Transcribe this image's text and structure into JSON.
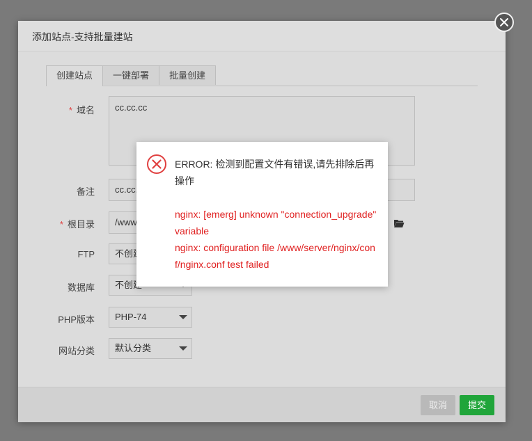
{
  "modal": {
    "title": "添加站点-支持批量建站",
    "tabs": [
      {
        "label": "创建站点",
        "active": true
      },
      {
        "label": "一键部署",
        "active": false
      },
      {
        "label": "批量创建",
        "active": false
      }
    ]
  },
  "form": {
    "domain": {
      "label": "域名",
      "required": true,
      "value": "cc.cc.cc"
    },
    "remark": {
      "label": "备注",
      "value": "cc.cc."
    },
    "root": {
      "label": "根目录",
      "required": true,
      "value": "/www"
    },
    "ftp": {
      "label": "FTP",
      "value": "不创建"
    },
    "database": {
      "label": "数据库",
      "value": "不创建"
    },
    "php": {
      "label": "PHP版本",
      "value": "PHP-74"
    },
    "category": {
      "label": "网站分类",
      "value": "默认分类"
    }
  },
  "footer": {
    "cancel_label": "取消",
    "submit_label": "提交"
  },
  "error_dialog": {
    "title": "ERROR: 检测到配置文件有错误,请先排除后再操作",
    "lines": [
      "nginx: [emerg] unknown \"connection_upgrade\" variable",
      "nginx: configuration file /www/server/nginx/conf/nginx.conf test failed"
    ]
  },
  "colors": {
    "accent": "#20a53a",
    "error": "#e02020"
  }
}
